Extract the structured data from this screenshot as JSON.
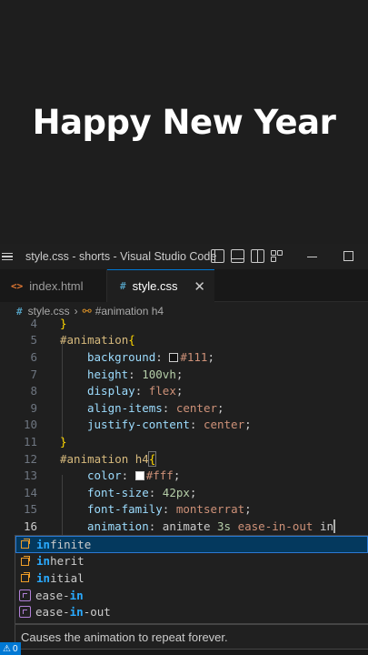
{
  "preview": {
    "heading": "Happy New Year"
  },
  "window": {
    "title": "style.css - shorts - Visual Studio Code"
  },
  "tabs": [
    {
      "label": "index.html",
      "icon": "html-file-icon"
    },
    {
      "label": "style.css",
      "icon": "css-file-icon"
    }
  ],
  "breadcrumb": {
    "file": "style.css",
    "symbol": "#animation h4"
  },
  "editor": {
    "lines": [
      {
        "n": "4",
        "text": "}"
      },
      {
        "n": "5",
        "text": "#animation{"
      },
      {
        "n": "6",
        "prop": "background",
        "value": "#111"
      },
      {
        "n": "7",
        "prop": "height",
        "value": "100vh"
      },
      {
        "n": "8",
        "prop": "display",
        "value": "flex"
      },
      {
        "n": "9",
        "prop": "align-items",
        "value": "center"
      },
      {
        "n": "10",
        "prop": "justify-content",
        "value": "center"
      },
      {
        "n": "11",
        "text": "}"
      },
      {
        "n": "12",
        "text": "#animation h4{"
      },
      {
        "n": "13",
        "prop": "color",
        "value": "#fff"
      },
      {
        "n": "14",
        "prop": "font-size",
        "value": "42px"
      },
      {
        "n": "15",
        "prop": "font-family",
        "value": "montserrat"
      },
      {
        "n": "16",
        "prop": "animation",
        "value_parts": [
          "animate",
          "3s",
          "ease-in-out",
          "in"
        ]
      }
    ]
  },
  "suggestions": [
    {
      "match": "in",
      "rest": "finite",
      "kind": "value",
      "selected": true
    },
    {
      "match": "in",
      "rest": "herit",
      "kind": "value"
    },
    {
      "match": "in",
      "rest": "itial",
      "kind": "value"
    },
    {
      "pre": "ease-",
      "match": "in",
      "rest": "",
      "kind": "property"
    },
    {
      "pre": "ease-",
      "match": "in",
      "rest": "-out",
      "kind": "property"
    }
  ],
  "suggestion_detail": "Causes the animation to repeat forever.",
  "status": {
    "warnings": "0"
  },
  "colors": {
    "accent": "#0078d4",
    "selector": "#d7ba7d",
    "property": "#9cdcfe",
    "value": "#ce9178",
    "match": "#2aaaff"
  }
}
